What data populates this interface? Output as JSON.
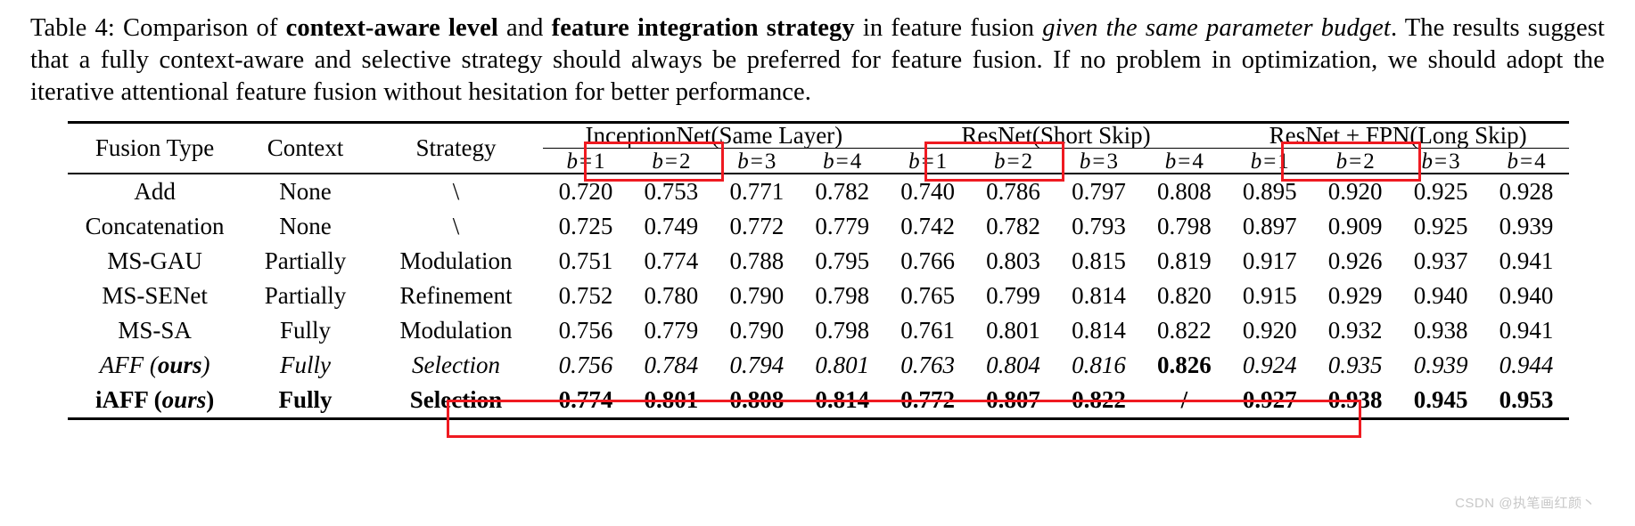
{
  "caption": {
    "prefix": "Table 4:  Comparison of ",
    "bold1": "context-aware level",
    "mid1": " and ",
    "bold2": "feature integration strategy",
    "mid2": " in feature fusion ",
    "italic1": "given the same parameter budget",
    "rest": ". The results suggest that a fully context-aware and selective strategy should always be preferred for feature fusion. If no problem in optimization, we should adopt the iterative attentional feature fusion without hesitation for better performance."
  },
  "table": {
    "row_headers": [
      "Fusion Type",
      "Context",
      "Strategy"
    ],
    "groups": [
      {
        "name": "InceptionNet",
        "highlight": "(Same Layer)"
      },
      {
        "name": "ResNet",
        "highlight": "(Short Skip)"
      },
      {
        "name": "ResNet + FPN",
        "highlight": "(Long Skip)"
      }
    ],
    "sub_headers": [
      "b = 1",
      "b = 2",
      "b = 3",
      "b = 4"
    ],
    "sub_symbol": "b",
    "sub_eq": "=",
    "sub_indices": [
      "1",
      "2",
      "3",
      "4"
    ],
    "rows": [
      {
        "type": "Add",
        "type_suffix": "",
        "context": "None",
        "strategy": "\\",
        "values": [
          "0.720",
          "0.753",
          "0.771",
          "0.782",
          "0.740",
          "0.786",
          "0.797",
          "0.808",
          "0.895",
          "0.920",
          "0.925",
          "0.928"
        ],
        "bold_indices": [],
        "style": "normal"
      },
      {
        "type": "Concatenation",
        "type_suffix": "",
        "context": "None",
        "strategy": "\\",
        "values": [
          "0.725",
          "0.749",
          "0.772",
          "0.779",
          "0.742",
          "0.782",
          "0.793",
          "0.798",
          "0.897",
          "0.909",
          "0.925",
          "0.939"
        ],
        "bold_indices": [],
        "style": "normal"
      },
      {
        "type": "MS-GAU",
        "type_suffix": "",
        "context": "Partially",
        "strategy": "Modulation",
        "values": [
          "0.751",
          "0.774",
          "0.788",
          "0.795",
          "0.766",
          "0.803",
          "0.815",
          "0.819",
          "0.917",
          "0.926",
          "0.937",
          "0.941"
        ],
        "bold_indices": [],
        "style": "normal"
      },
      {
        "type": "MS-SENet",
        "type_suffix": "",
        "context": "Partially",
        "strategy": "Refinement",
        "values": [
          "0.752",
          "0.780",
          "0.790",
          "0.798",
          "0.765",
          "0.799",
          "0.814",
          "0.820",
          "0.915",
          "0.929",
          "0.940",
          "0.940"
        ],
        "bold_indices": [],
        "style": "normal"
      },
      {
        "type": "MS-SA",
        "type_suffix": "",
        "context": "Fully",
        "strategy": "Modulation",
        "values": [
          "0.756",
          "0.779",
          "0.790",
          "0.798",
          "0.761",
          "0.801",
          "0.814",
          "0.822",
          "0.920",
          "0.932",
          "0.938",
          "0.941"
        ],
        "bold_indices": [],
        "style": "normal"
      },
      {
        "type": "AFF (",
        "type_suffix": "ours",
        "type_close": ")",
        "context": "Fully",
        "strategy": "Selection",
        "values": [
          "0.756",
          "0.784",
          "0.794",
          "0.801",
          "0.763",
          "0.804",
          "0.816",
          "0.826",
          "0.924",
          "0.935",
          "0.939",
          "0.944"
        ],
        "bold_indices": [
          7
        ],
        "style": "italic"
      },
      {
        "type": "iAFF (",
        "type_suffix": "ours",
        "type_close": ")",
        "context": "Fully",
        "strategy": "Selection",
        "values": [
          "0.774",
          "0.801",
          "0.808",
          "0.814",
          "0.772",
          "0.807",
          "0.822",
          "/",
          "0.927",
          "0.938",
          "0.945",
          "0.953"
        ],
        "bold_indices": [],
        "style": "bold"
      }
    ]
  },
  "annotations": {
    "box_color": "#ef1a21",
    "boxes": [
      "same-layer-box",
      "short-skip-box",
      "long-skip-box",
      "iaff-row-box"
    ]
  },
  "watermark": "CSDN @执笔画红颜丶"
}
